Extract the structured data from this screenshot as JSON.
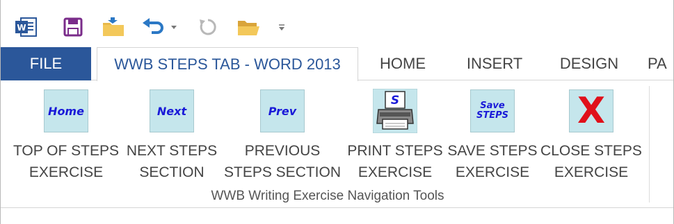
{
  "quick_access": {
    "icons": [
      "word-app-icon",
      "save-icon",
      "open-folder-icon",
      "undo-icon",
      "undo-dropdown-icon",
      "redo-icon",
      "folder-icon",
      "customize-toolbar-icon"
    ],
    "word_letter": "W"
  },
  "tabs": [
    {
      "label": "FILE"
    },
    {
      "label": "WWB STEPS TAB - WORD 2013"
    },
    {
      "label": "HOME"
    },
    {
      "label": "INSERT"
    },
    {
      "label": "DESIGN"
    },
    {
      "label": "PA"
    }
  ],
  "ribbon": {
    "group_label": "WWB Writing Exercise Navigation Tools",
    "buttons": [
      {
        "icon_text": "Home",
        "line1": "TOP OF STEPS",
        "line2": "EXERCISE"
      },
      {
        "icon_text": "Next",
        "line1": "NEXT STEPS",
        "line2": "SECTION"
      },
      {
        "icon_text": "Prev",
        "line1": "PREVIOUS",
        "line2": "STEPS SECTION"
      },
      {
        "icon_text": "S",
        "line1": "PRINT STEPS",
        "line2": "EXERCISE"
      },
      {
        "icon_text_1": "Save",
        "icon_text_2": "STEPS",
        "line1": "SAVE STEPS",
        "line2": "EXERCISE"
      },
      {
        "icon_text": "X",
        "line1": "CLOSE STEPS",
        "line2": "EXERCISE"
      }
    ]
  },
  "colors": {
    "accent": "#2b579a",
    "icon_bg": "#c5e6ec",
    "icon_text": "#1a1ad8",
    "close_red": "#e0101a"
  }
}
